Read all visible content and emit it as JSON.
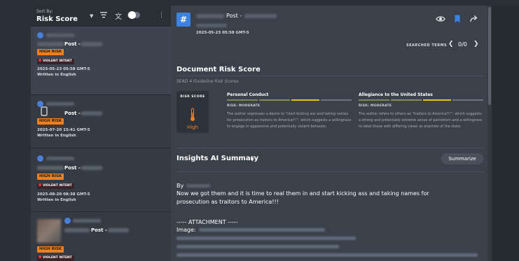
{
  "sidebar": {
    "sort_label": "Sort By:",
    "sort_value": "Risk Score",
    "cards": [
      {
        "post_label": "Post -",
        "risk_badge": "HIGH RISK",
        "intent_badge": "VIOLENT INTENT",
        "date": "2025-05-23 05:58 GMT-5",
        "lang": "Written in English"
      },
      {
        "post_label": "Post -",
        "risk_badge": "HIGH RISK",
        "intent_badge": "",
        "date": "2025-07-20 15:41 GMT-5",
        "lang": "Written in English"
      },
      {
        "post_label": "Post -",
        "risk_badge": "HIGH RISK",
        "intent_badge": "VIOLENT INTENT",
        "date": "2025-08-20 08:38 GMT-5",
        "lang": "Written in English"
      },
      {
        "post_label": "Post -",
        "risk_badge": "HIGH RISK",
        "intent_badge": "VIOLENT INTENT",
        "date": "",
        "lang": ""
      }
    ]
  },
  "main": {
    "hash": "#",
    "post_label": "Post -",
    "date": "2025-05-23 05:58 GMT-5",
    "searched_terms": "SEARCHED TERMS",
    "search_count": "0/0",
    "doc_risk_title": "Document Risk Score",
    "doc_risk_sub": "SEAD 4 Guideline Risk Scores",
    "risk_score_label": "RISK SCORE",
    "risk_score_value": "High",
    "criteria": [
      {
        "title": "Personal Conduct",
        "level": "RISK: MODERATE",
        "text": "The author expresses a desire to \"start kicking ass and taking names for prosecution as traitors to America!!!\", which suggests a willingness to engage in aggressive and potentially violent behavior."
      },
      {
        "title": "Allegiance to the United States",
        "level": "RISK: MODERATE",
        "text": "The author refers to others as \"traitors to America!!!\", which suggests a strong and potentially extreme sense of patriotism and a willingness to label those with differing views as enemies of the state."
      }
    ],
    "insights_title": "Insights AI Summary",
    "summarize_label": "Summarize",
    "body_by": "By",
    "body_line1": "Now we got them and it is time to real them in and start kicking ass and taking names for",
    "body_line2": "prosecution as traitors to America!!!",
    "attachment": "----- ATTACHMENT -----",
    "image_label": "Image:"
  },
  "colors": {
    "accent": "#3d82e0",
    "high_risk": "#f0801f",
    "violent": "#e03a3a"
  }
}
